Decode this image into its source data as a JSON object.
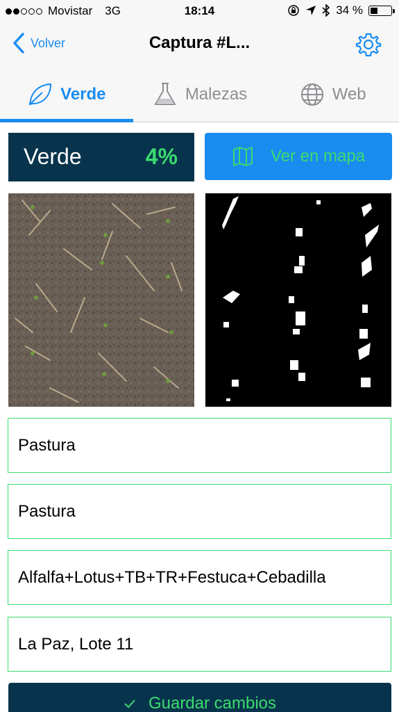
{
  "status_bar": {
    "carrier": "Movistar",
    "network": "3G",
    "time": "18:14",
    "battery_text": "34 %",
    "battery_level": 0.34
  },
  "nav": {
    "back_label": "Volver",
    "title": "Captura #L..."
  },
  "tabs": [
    {
      "label": "Verde",
      "icon": "leaf-icon",
      "active": true
    },
    {
      "label": "Malezas",
      "icon": "flask-icon",
      "active": false
    },
    {
      "label": "Web",
      "icon": "globe-icon",
      "active": false
    }
  ],
  "summary": {
    "label": "Verde",
    "percent": "4%"
  },
  "map_button": {
    "label": "Ver en mapa",
    "icon": "map-icon"
  },
  "fields": [
    {
      "value": "Pastura"
    },
    {
      "value": "Pastura"
    },
    {
      "value": "Alfalfa+Lotus+TB+TR+Festuca+Cebadilla"
    },
    {
      "value": "La Paz, Lote 11"
    }
  ],
  "save_button": {
    "label": "Guardar cambios",
    "icon": "checkmark-icon"
  },
  "colors": {
    "accent_blue": "#1a8cf0",
    "accent_green": "#3bdb6f",
    "dark_navy": "#07344c"
  }
}
